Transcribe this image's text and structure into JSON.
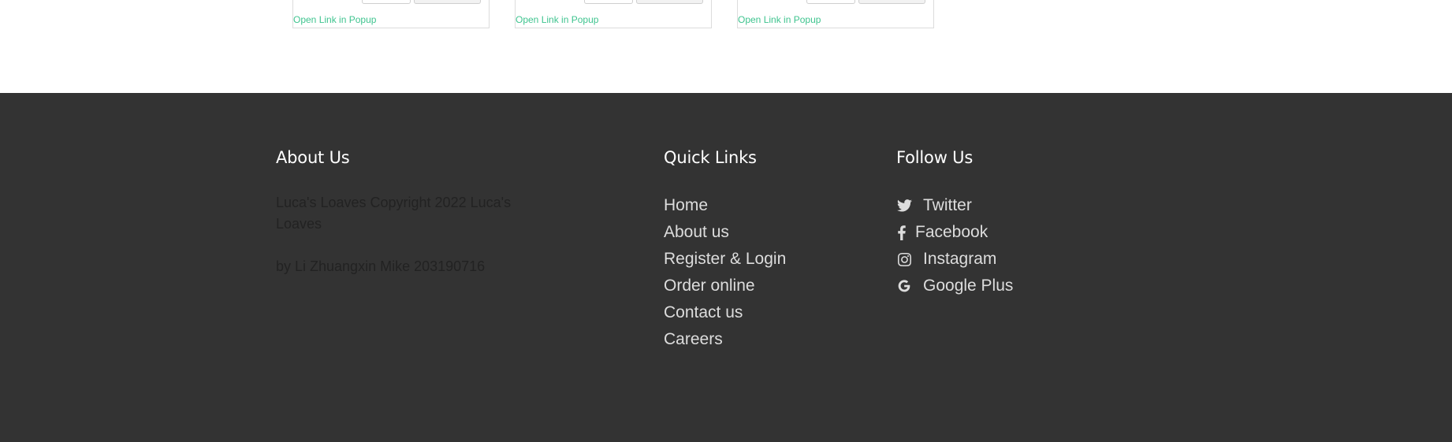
{
  "cards": [
    {
      "link_label": "Open Link in Popup"
    },
    {
      "link_label": "Open Link in Popup"
    },
    {
      "link_label": "Open Link in Popup"
    }
  ],
  "footer": {
    "about": {
      "heading": "About Us",
      "copyright": "Luca's Loaves Copyright 2022 Luca's Loaves",
      "author": "by Li Zhuangxin Mike 203190716"
    },
    "quick_links": {
      "heading": "Quick Links",
      "items": [
        {
          "label": "Home"
        },
        {
          "label": "About us"
        },
        {
          "label": "Register & Login"
        },
        {
          "label": "Order online"
        },
        {
          "label": "Contact us"
        },
        {
          "label": "Careers"
        }
      ]
    },
    "follow": {
      "heading": "Follow Us",
      "items": [
        {
          "label": "Twitter",
          "icon": "twitter-icon"
        },
        {
          "label": "Facebook",
          "icon": "facebook-icon"
        },
        {
          "label": "Instagram",
          "icon": "instagram-icon"
        },
        {
          "label": "Google Plus",
          "icon": "google-icon"
        }
      ]
    }
  },
  "colors": {
    "footer_bg": "#333333",
    "link_accent": "#3fc48f",
    "footer_text": "#dddddd"
  }
}
